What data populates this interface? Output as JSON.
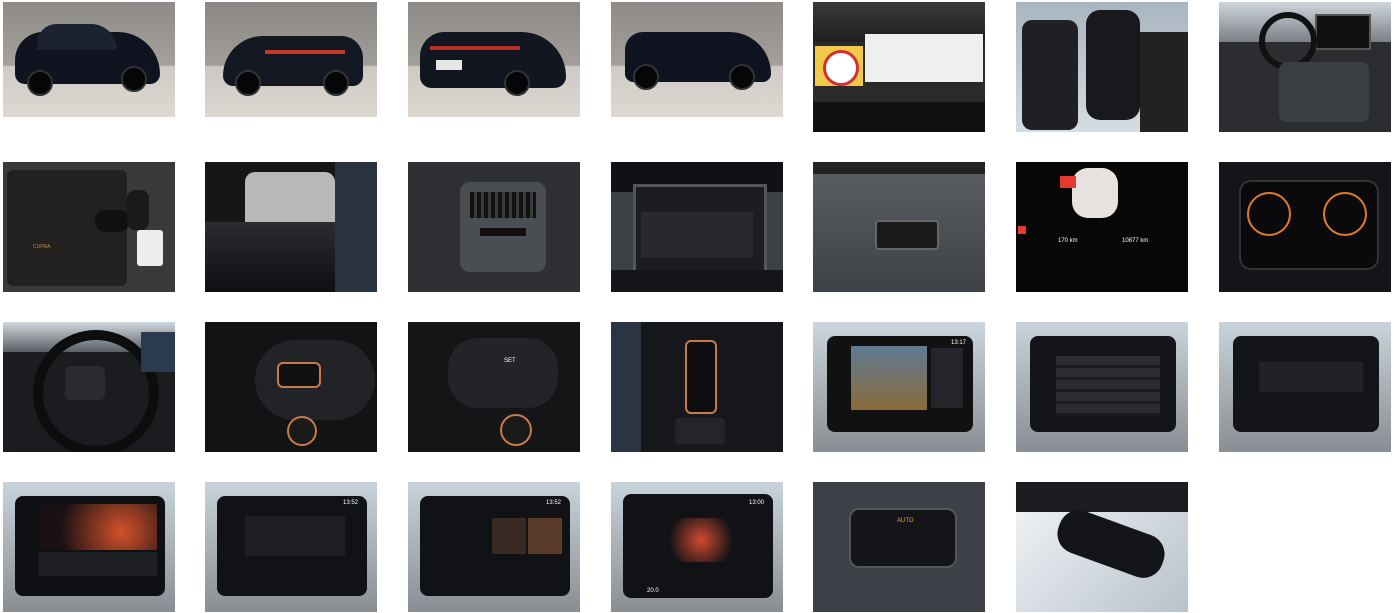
{
  "gallery": {
    "photos": [
      {
        "id": 1,
        "subject": "exterior-front-3q"
      },
      {
        "id": 2,
        "subject": "exterior-rear-3q-left"
      },
      {
        "id": 3,
        "subject": "exterior-rear-3q-right"
      },
      {
        "id": 4,
        "subject": "exterior-side-front"
      },
      {
        "id": 5,
        "subject": "engine-bay-sticker"
      },
      {
        "id": 6,
        "subject": "front-seats"
      },
      {
        "id": 7,
        "subject": "dashboard-center-console"
      },
      {
        "id": 8,
        "subject": "manual-folder-keys",
        "text": "CUPRA"
      },
      {
        "id": 9,
        "subject": "trunk-cover"
      },
      {
        "id": 10,
        "subject": "rear-vents"
      },
      {
        "id": 11,
        "subject": "open-trunk"
      },
      {
        "id": 12,
        "subject": "trunk-button"
      },
      {
        "id": 13,
        "subject": "instrument-cluster-range",
        "range": "170 km",
        "odometer": "10877 km"
      },
      {
        "id": 14,
        "subject": "instrument-cluster-gauges"
      },
      {
        "id": 15,
        "subject": "steering-wheel"
      },
      {
        "id": 16,
        "subject": "steering-wheel-left-buttons"
      },
      {
        "id": 17,
        "subject": "steering-wheel-right-buttons",
        "text": "SET"
      },
      {
        "id": 18,
        "subject": "gear-selector"
      },
      {
        "id": 19,
        "subject": "infotainment-parking-camera",
        "time": "13:17"
      },
      {
        "id": 20,
        "subject": "infotainment-media"
      },
      {
        "id": 21,
        "subject": "infotainment-settings"
      },
      {
        "id": 22,
        "subject": "infotainment-ambient"
      },
      {
        "id": 23,
        "subject": "infotainment-drive-profile",
        "time": "13:52"
      },
      {
        "id": 24,
        "subject": "infotainment-seat"
      },
      {
        "id": 25,
        "subject": "infotainment-climate",
        "time": "13:00"
      },
      {
        "id": 26,
        "subject": "climate-buttons",
        "text": "AUTO"
      },
      {
        "id": 27,
        "subject": "rearview-mirror"
      }
    ],
    "labels": {
      "brand": "CUPRA",
      "range": "170 km",
      "odometer": "10877 km",
      "set": "SET",
      "auto": "AUTO",
      "time_a": "13:17",
      "time_b": "13:52",
      "time_c": "13:00",
      "temp": "20.0"
    }
  }
}
